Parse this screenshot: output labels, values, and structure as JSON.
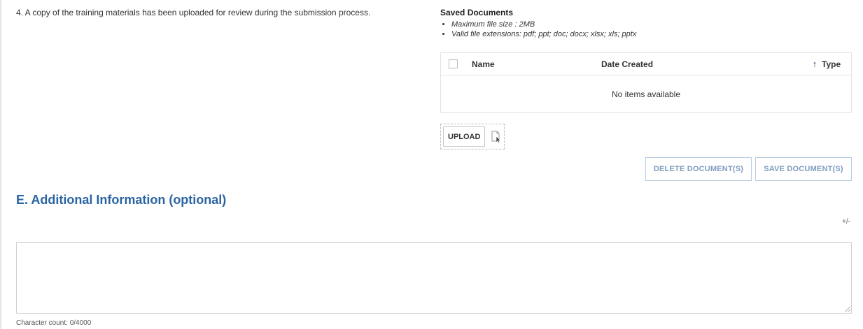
{
  "question": {
    "text": "4. A copy of the training materials has been uploaded for review during the submission process."
  },
  "saved_documents": {
    "title": "Saved Documents",
    "notes": [
      "Maximum file size : 2MB",
      "Valid file extensions: pdf; ppt; doc; docx; xlsx; xls; pptx"
    ],
    "table": {
      "columns": [
        "Name",
        "Date Created",
        "Type"
      ],
      "sort_icon": "arrow-up-icon",
      "empty_message": "No items available"
    },
    "upload_label": "UPLOAD",
    "upload_icon": "file-select-icon",
    "delete_label": "DELETE DOCUMENT(S)",
    "save_label": "SAVE DOCUMENT(S)"
  },
  "additional_info": {
    "title": "E. Additional Information (optional)",
    "toggle": "+/-",
    "value": "",
    "char_count": "Character count: 0/4000"
  },
  "colors": {
    "heading": "#2b64a2",
    "disabled_button_text": "#7e9cc0",
    "disabled_button_border": "#b8cde3"
  }
}
